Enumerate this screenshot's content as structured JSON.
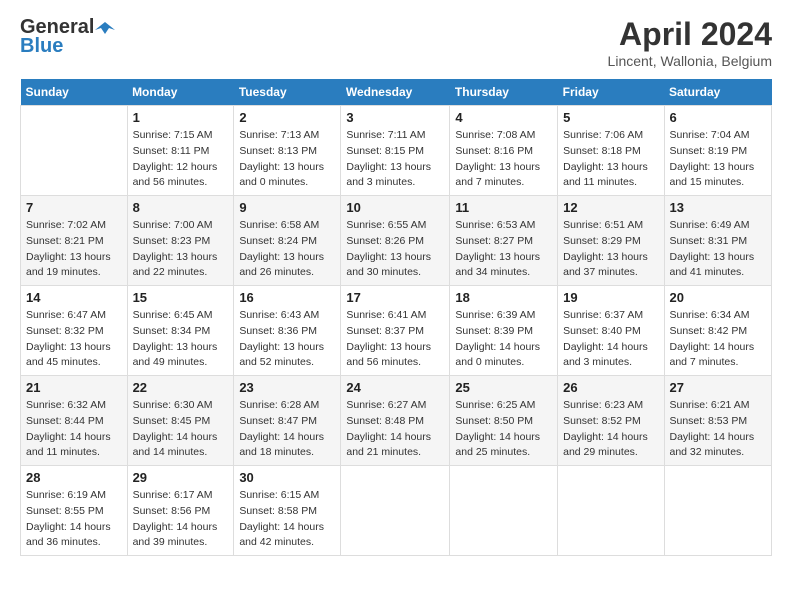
{
  "logo": {
    "general": "General",
    "blue": "Blue"
  },
  "header": {
    "month_year": "April 2024",
    "location": "Lincent, Wallonia, Belgium"
  },
  "days_of_week": [
    "Sunday",
    "Monday",
    "Tuesday",
    "Wednesday",
    "Thursday",
    "Friday",
    "Saturday"
  ],
  "weeks": [
    [
      {
        "day": "",
        "info": ""
      },
      {
        "day": "1",
        "info": "Sunrise: 7:15 AM\nSunset: 8:11 PM\nDaylight: 12 hours\nand 56 minutes."
      },
      {
        "day": "2",
        "info": "Sunrise: 7:13 AM\nSunset: 8:13 PM\nDaylight: 13 hours\nand 0 minutes."
      },
      {
        "day": "3",
        "info": "Sunrise: 7:11 AM\nSunset: 8:15 PM\nDaylight: 13 hours\nand 3 minutes."
      },
      {
        "day": "4",
        "info": "Sunrise: 7:08 AM\nSunset: 8:16 PM\nDaylight: 13 hours\nand 7 minutes."
      },
      {
        "day": "5",
        "info": "Sunrise: 7:06 AM\nSunset: 8:18 PM\nDaylight: 13 hours\nand 11 minutes."
      },
      {
        "day": "6",
        "info": "Sunrise: 7:04 AM\nSunset: 8:19 PM\nDaylight: 13 hours\nand 15 minutes."
      }
    ],
    [
      {
        "day": "7",
        "info": "Sunrise: 7:02 AM\nSunset: 8:21 PM\nDaylight: 13 hours\nand 19 minutes."
      },
      {
        "day": "8",
        "info": "Sunrise: 7:00 AM\nSunset: 8:23 PM\nDaylight: 13 hours\nand 22 minutes."
      },
      {
        "day": "9",
        "info": "Sunrise: 6:58 AM\nSunset: 8:24 PM\nDaylight: 13 hours\nand 26 minutes."
      },
      {
        "day": "10",
        "info": "Sunrise: 6:55 AM\nSunset: 8:26 PM\nDaylight: 13 hours\nand 30 minutes."
      },
      {
        "day": "11",
        "info": "Sunrise: 6:53 AM\nSunset: 8:27 PM\nDaylight: 13 hours\nand 34 minutes."
      },
      {
        "day": "12",
        "info": "Sunrise: 6:51 AM\nSunset: 8:29 PM\nDaylight: 13 hours\nand 37 minutes."
      },
      {
        "day": "13",
        "info": "Sunrise: 6:49 AM\nSunset: 8:31 PM\nDaylight: 13 hours\nand 41 minutes."
      }
    ],
    [
      {
        "day": "14",
        "info": "Sunrise: 6:47 AM\nSunset: 8:32 PM\nDaylight: 13 hours\nand 45 minutes."
      },
      {
        "day": "15",
        "info": "Sunrise: 6:45 AM\nSunset: 8:34 PM\nDaylight: 13 hours\nand 49 minutes."
      },
      {
        "day": "16",
        "info": "Sunrise: 6:43 AM\nSunset: 8:36 PM\nDaylight: 13 hours\nand 52 minutes."
      },
      {
        "day": "17",
        "info": "Sunrise: 6:41 AM\nSunset: 8:37 PM\nDaylight: 13 hours\nand 56 minutes."
      },
      {
        "day": "18",
        "info": "Sunrise: 6:39 AM\nSunset: 8:39 PM\nDaylight: 14 hours\nand 0 minutes."
      },
      {
        "day": "19",
        "info": "Sunrise: 6:37 AM\nSunset: 8:40 PM\nDaylight: 14 hours\nand 3 minutes."
      },
      {
        "day": "20",
        "info": "Sunrise: 6:34 AM\nSunset: 8:42 PM\nDaylight: 14 hours\nand 7 minutes."
      }
    ],
    [
      {
        "day": "21",
        "info": "Sunrise: 6:32 AM\nSunset: 8:44 PM\nDaylight: 14 hours\nand 11 minutes."
      },
      {
        "day": "22",
        "info": "Sunrise: 6:30 AM\nSunset: 8:45 PM\nDaylight: 14 hours\nand 14 minutes."
      },
      {
        "day": "23",
        "info": "Sunrise: 6:28 AM\nSunset: 8:47 PM\nDaylight: 14 hours\nand 18 minutes."
      },
      {
        "day": "24",
        "info": "Sunrise: 6:27 AM\nSunset: 8:48 PM\nDaylight: 14 hours\nand 21 minutes."
      },
      {
        "day": "25",
        "info": "Sunrise: 6:25 AM\nSunset: 8:50 PM\nDaylight: 14 hours\nand 25 minutes."
      },
      {
        "day": "26",
        "info": "Sunrise: 6:23 AM\nSunset: 8:52 PM\nDaylight: 14 hours\nand 29 minutes."
      },
      {
        "day": "27",
        "info": "Sunrise: 6:21 AM\nSunset: 8:53 PM\nDaylight: 14 hours\nand 32 minutes."
      }
    ],
    [
      {
        "day": "28",
        "info": "Sunrise: 6:19 AM\nSunset: 8:55 PM\nDaylight: 14 hours\nand 36 minutes."
      },
      {
        "day": "29",
        "info": "Sunrise: 6:17 AM\nSunset: 8:56 PM\nDaylight: 14 hours\nand 39 minutes."
      },
      {
        "day": "30",
        "info": "Sunrise: 6:15 AM\nSunset: 8:58 PM\nDaylight: 14 hours\nand 42 minutes."
      },
      {
        "day": "",
        "info": ""
      },
      {
        "day": "",
        "info": ""
      },
      {
        "day": "",
        "info": ""
      },
      {
        "day": "",
        "info": ""
      }
    ]
  ]
}
